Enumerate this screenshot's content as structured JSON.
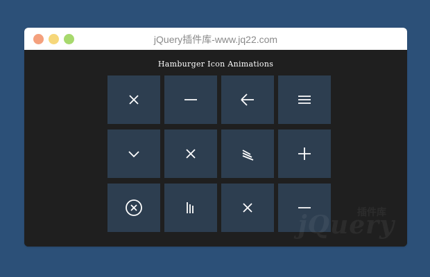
{
  "window": {
    "title": "jQuery插件库-www.jq22.com",
    "controls": [
      "close",
      "minimize",
      "zoom"
    ]
  },
  "page": {
    "heading": "Hamburger Icon Animations"
  },
  "tiles": [
    {
      "icon": "x-icon"
    },
    {
      "icon": "minus-icon"
    },
    {
      "icon": "arrow-left-icon"
    },
    {
      "icon": "menu-icon"
    },
    {
      "icon": "chevron-down-icon"
    },
    {
      "icon": "x-icon"
    },
    {
      "icon": "slanted-lines-icon"
    },
    {
      "icon": "plus-icon"
    },
    {
      "icon": "circle-x-icon"
    },
    {
      "icon": "vertical-lines-icon"
    },
    {
      "icon": "x-icon"
    },
    {
      "icon": "minus-icon"
    }
  ],
  "watermark": {
    "logo": "jQuery",
    "sub": "插件库"
  },
  "colors": {
    "background": "#2c5078",
    "window_bg": "#1f1f1f",
    "tile_bg": "#2d3e50",
    "icon": "#ffffff"
  }
}
